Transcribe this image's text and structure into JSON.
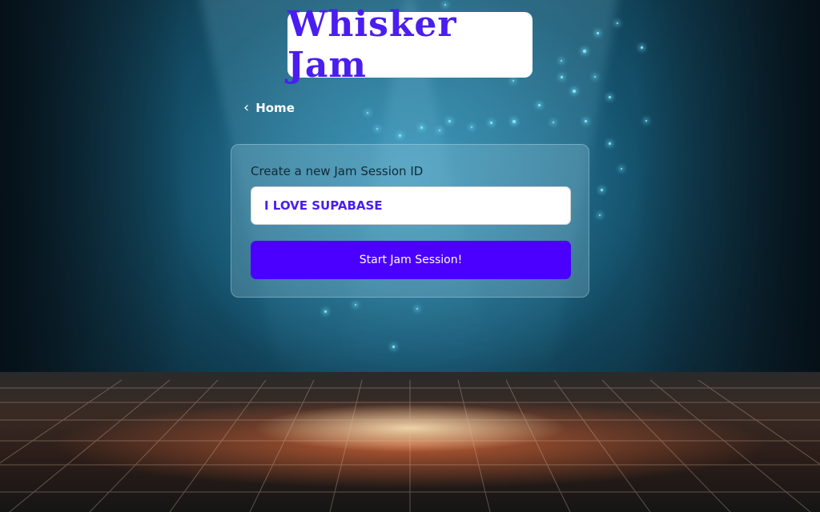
{
  "header": {
    "app_title": "Whisker Jam"
  },
  "nav": {
    "home_label": "Home",
    "back_icon": "chevron-left-icon"
  },
  "form": {
    "label": "Create a new Jam Session ID",
    "session_input_value": "I LOVE SUPABASE",
    "start_button_label": "Start Jam Session!"
  },
  "colors": {
    "accent": "#4b00ff",
    "logo_text": "#4a1df0"
  }
}
